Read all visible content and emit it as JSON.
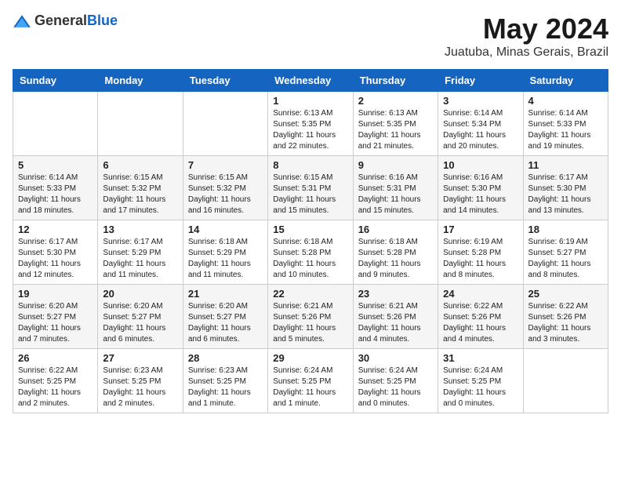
{
  "header": {
    "logo_general": "General",
    "logo_blue": "Blue",
    "title": "May 2024",
    "subtitle": "Juatuba, Minas Gerais, Brazil"
  },
  "days_of_week": [
    "Sunday",
    "Monday",
    "Tuesday",
    "Wednesday",
    "Thursday",
    "Friday",
    "Saturday"
  ],
  "weeks": [
    [
      {
        "day": "",
        "info": ""
      },
      {
        "day": "",
        "info": ""
      },
      {
        "day": "",
        "info": ""
      },
      {
        "day": "1",
        "info": "Sunrise: 6:13 AM\nSunset: 5:35 PM\nDaylight: 11 hours\nand 22 minutes."
      },
      {
        "day": "2",
        "info": "Sunrise: 6:13 AM\nSunset: 5:35 PM\nDaylight: 11 hours\nand 21 minutes."
      },
      {
        "day": "3",
        "info": "Sunrise: 6:14 AM\nSunset: 5:34 PM\nDaylight: 11 hours\nand 20 minutes."
      },
      {
        "day": "4",
        "info": "Sunrise: 6:14 AM\nSunset: 5:33 PM\nDaylight: 11 hours\nand 19 minutes."
      }
    ],
    [
      {
        "day": "5",
        "info": "Sunrise: 6:14 AM\nSunset: 5:33 PM\nDaylight: 11 hours\nand 18 minutes."
      },
      {
        "day": "6",
        "info": "Sunrise: 6:15 AM\nSunset: 5:32 PM\nDaylight: 11 hours\nand 17 minutes."
      },
      {
        "day": "7",
        "info": "Sunrise: 6:15 AM\nSunset: 5:32 PM\nDaylight: 11 hours\nand 16 minutes."
      },
      {
        "day": "8",
        "info": "Sunrise: 6:15 AM\nSunset: 5:31 PM\nDaylight: 11 hours\nand 15 minutes."
      },
      {
        "day": "9",
        "info": "Sunrise: 6:16 AM\nSunset: 5:31 PM\nDaylight: 11 hours\nand 15 minutes."
      },
      {
        "day": "10",
        "info": "Sunrise: 6:16 AM\nSunset: 5:30 PM\nDaylight: 11 hours\nand 14 minutes."
      },
      {
        "day": "11",
        "info": "Sunrise: 6:17 AM\nSunset: 5:30 PM\nDaylight: 11 hours\nand 13 minutes."
      }
    ],
    [
      {
        "day": "12",
        "info": "Sunrise: 6:17 AM\nSunset: 5:30 PM\nDaylight: 11 hours\nand 12 minutes."
      },
      {
        "day": "13",
        "info": "Sunrise: 6:17 AM\nSunset: 5:29 PM\nDaylight: 11 hours\nand 11 minutes."
      },
      {
        "day": "14",
        "info": "Sunrise: 6:18 AM\nSunset: 5:29 PM\nDaylight: 11 hours\nand 11 minutes."
      },
      {
        "day": "15",
        "info": "Sunrise: 6:18 AM\nSunset: 5:28 PM\nDaylight: 11 hours\nand 10 minutes."
      },
      {
        "day": "16",
        "info": "Sunrise: 6:18 AM\nSunset: 5:28 PM\nDaylight: 11 hours\nand 9 minutes."
      },
      {
        "day": "17",
        "info": "Sunrise: 6:19 AM\nSunset: 5:28 PM\nDaylight: 11 hours\nand 8 minutes."
      },
      {
        "day": "18",
        "info": "Sunrise: 6:19 AM\nSunset: 5:27 PM\nDaylight: 11 hours\nand 8 minutes."
      }
    ],
    [
      {
        "day": "19",
        "info": "Sunrise: 6:20 AM\nSunset: 5:27 PM\nDaylight: 11 hours\nand 7 minutes."
      },
      {
        "day": "20",
        "info": "Sunrise: 6:20 AM\nSunset: 5:27 PM\nDaylight: 11 hours\nand 6 minutes."
      },
      {
        "day": "21",
        "info": "Sunrise: 6:20 AM\nSunset: 5:27 PM\nDaylight: 11 hours\nand 6 minutes."
      },
      {
        "day": "22",
        "info": "Sunrise: 6:21 AM\nSunset: 5:26 PM\nDaylight: 11 hours\nand 5 minutes."
      },
      {
        "day": "23",
        "info": "Sunrise: 6:21 AM\nSunset: 5:26 PM\nDaylight: 11 hours\nand 4 minutes."
      },
      {
        "day": "24",
        "info": "Sunrise: 6:22 AM\nSunset: 5:26 PM\nDaylight: 11 hours\nand 4 minutes."
      },
      {
        "day": "25",
        "info": "Sunrise: 6:22 AM\nSunset: 5:26 PM\nDaylight: 11 hours\nand 3 minutes."
      }
    ],
    [
      {
        "day": "26",
        "info": "Sunrise: 6:22 AM\nSunset: 5:25 PM\nDaylight: 11 hours\nand 2 minutes."
      },
      {
        "day": "27",
        "info": "Sunrise: 6:23 AM\nSunset: 5:25 PM\nDaylight: 11 hours\nand 2 minutes."
      },
      {
        "day": "28",
        "info": "Sunrise: 6:23 AM\nSunset: 5:25 PM\nDaylight: 11 hours\nand 1 minute."
      },
      {
        "day": "29",
        "info": "Sunrise: 6:24 AM\nSunset: 5:25 PM\nDaylight: 11 hours\nand 1 minute."
      },
      {
        "day": "30",
        "info": "Sunrise: 6:24 AM\nSunset: 5:25 PM\nDaylight: 11 hours\nand 0 minutes."
      },
      {
        "day": "31",
        "info": "Sunrise: 6:24 AM\nSunset: 5:25 PM\nDaylight: 11 hours\nand 0 minutes."
      },
      {
        "day": "",
        "info": ""
      }
    ]
  ]
}
